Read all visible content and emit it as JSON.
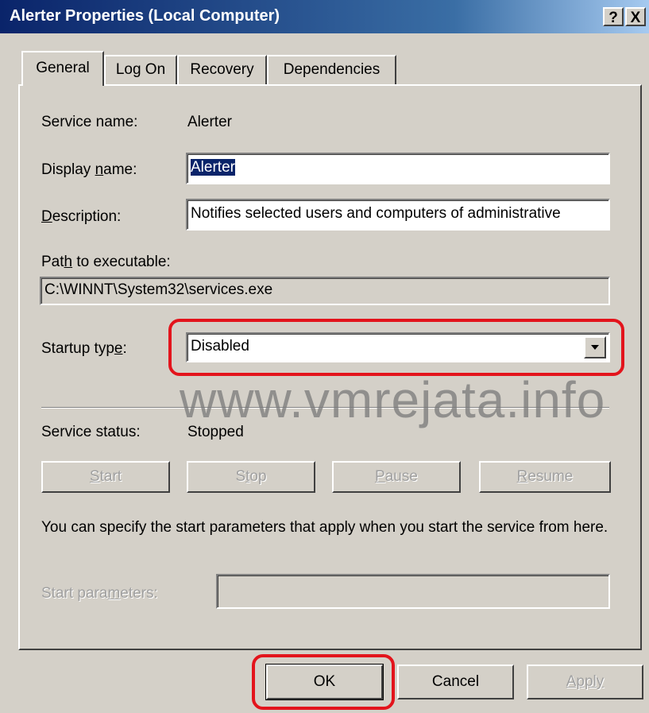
{
  "window": {
    "title": "Alerter Properties (Local Computer)",
    "help_button": "?",
    "close_button": "X"
  },
  "tabs": [
    {
      "label": "General",
      "active": true
    },
    {
      "label": "Log On",
      "active": false
    },
    {
      "label": "Recovery",
      "active": false
    },
    {
      "label": "Dependencies",
      "active": false
    }
  ],
  "general": {
    "service_name_label": "Service name:",
    "service_name_value": "Alerter",
    "display_name_label_pre": "Display ",
    "display_name_label_u": "n",
    "display_name_label_post": "ame:",
    "display_name_value": "Alerter",
    "description_label_u": "D",
    "description_label_post": "escription:",
    "description_value": "Notifies selected users and computers of administrative",
    "path_label_pre": "Pat",
    "path_label_u": "h",
    "path_label_post": " to executable:",
    "path_value": "C:\\WINNT\\System32\\services.exe",
    "startup_label_pre": "Startup typ",
    "startup_label_u": "e",
    "startup_label_post": ":",
    "startup_value": "Disabled",
    "service_status_label": "Service status:",
    "service_status_value": "Stopped",
    "buttons": {
      "start": {
        "u": "S",
        "rest": "tart"
      },
      "stop": {
        "pre": "S",
        "u": "t",
        "rest": "op"
      },
      "pause": {
        "u": "P",
        "rest": "ause"
      },
      "resume": {
        "u": "R",
        "rest": "esume"
      }
    },
    "info_text": "You can specify the start parameters that apply when you start the service from here.",
    "start_params_label_pre": "Start para",
    "start_params_label_u": "m",
    "start_params_label_post": "eters:",
    "start_params_value": ""
  },
  "footer": {
    "ok": "OK",
    "cancel": "Cancel",
    "apply": "Apply"
  },
  "watermark": "www.vmrejata.info",
  "colors": {
    "dialog_bg": "#d4d0c8",
    "title_bar": "#0a246a",
    "highlight_annotation": "#e3141c"
  }
}
